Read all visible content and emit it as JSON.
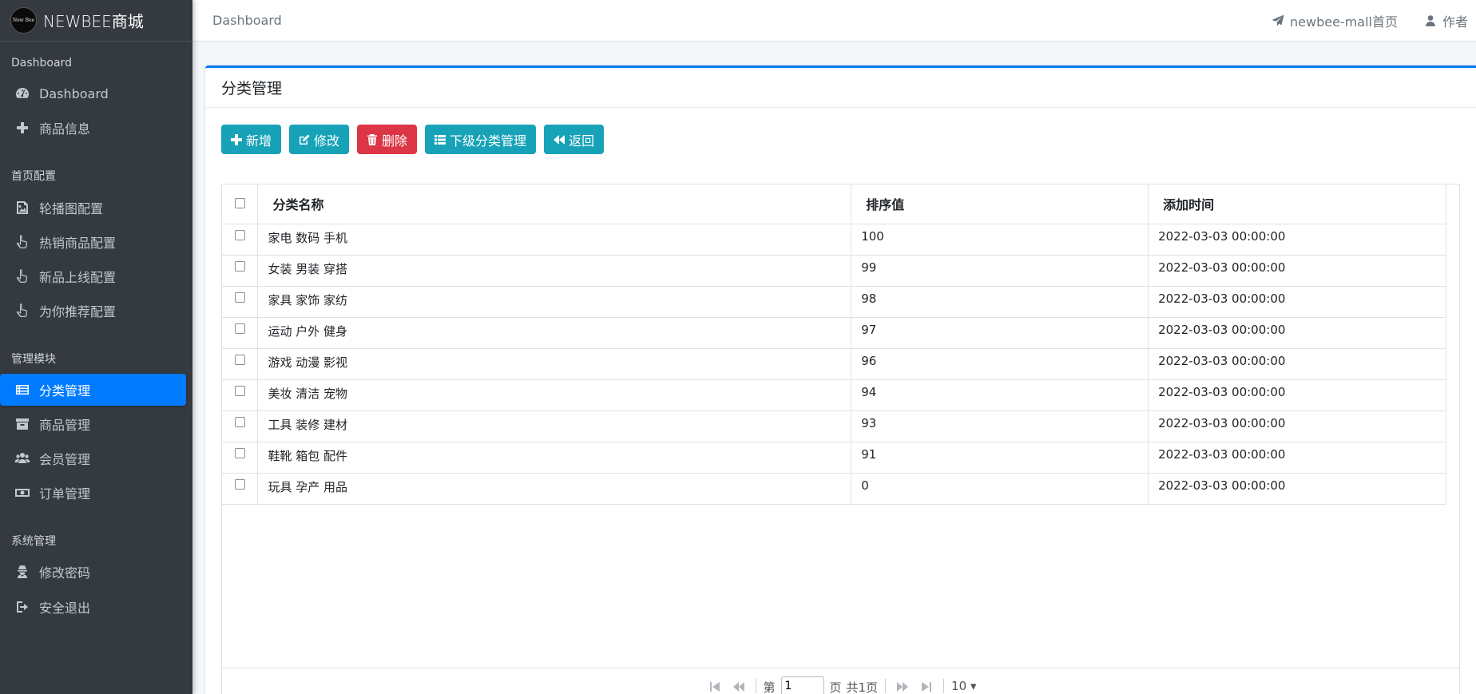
{
  "brand": {
    "logo_text": "New Bee",
    "title": "NEWBEE商城"
  },
  "topbar": {
    "left_label": "Dashboard",
    "links": [
      {
        "icon": "paper-plane-icon",
        "label": "newbee-mall首页"
      },
      {
        "icon": "user-icon",
        "label": "作者"
      }
    ]
  },
  "sidebar": {
    "sections": [
      {
        "header": "Dashboard",
        "items": [
          {
            "icon": "tachometer-icon",
            "label": "Dashboard"
          },
          {
            "icon": "plus-icon",
            "label": "商品信息"
          }
        ]
      },
      {
        "header": "首页配置",
        "items": [
          {
            "icon": "image-icon",
            "label": "轮播图配置"
          },
          {
            "icon": "pointer-hand-icon",
            "label": "热销商品配置"
          },
          {
            "icon": "pointer-hand-icon",
            "label": "新品上线配置"
          },
          {
            "icon": "pointer-hand-icon",
            "label": "为你推荐配置"
          }
        ]
      },
      {
        "header": "管理模块",
        "items": [
          {
            "icon": "list-icon",
            "label": "分类管理",
            "active": true
          },
          {
            "icon": "archive-icon",
            "label": "商品管理"
          },
          {
            "icon": "users-icon",
            "label": "会员管理"
          },
          {
            "icon": "money-icon",
            "label": "订单管理"
          }
        ]
      },
      {
        "header": "系统管理",
        "items": [
          {
            "icon": "user-secret-icon",
            "label": "修改密码"
          },
          {
            "icon": "sign-out-icon",
            "label": "安全退出"
          }
        ]
      }
    ]
  },
  "card": {
    "title": "分类管理",
    "buttons": [
      {
        "icon": "plus-icon",
        "label": "新增",
        "style": "info"
      },
      {
        "icon": "edit-icon",
        "label": "修改",
        "style": "info"
      },
      {
        "icon": "trash-icon",
        "label": "删除",
        "style": "danger"
      },
      {
        "icon": "list-icon",
        "label": "下级分类管理",
        "style": "info"
      },
      {
        "icon": "backward-icon",
        "label": "返回",
        "style": "info"
      }
    ]
  },
  "table": {
    "columns": [
      "分类名称",
      "排序值",
      "添加时间"
    ],
    "rows": [
      {
        "name": "家电 数码 手机",
        "sort": "100",
        "time": "2022-03-03 00:00:00"
      },
      {
        "name": "女装 男装 穿搭",
        "sort": "99",
        "time": "2022-03-03 00:00:00"
      },
      {
        "name": "家具 家饰 家纺",
        "sort": "98",
        "time": "2022-03-03 00:00:00"
      },
      {
        "name": "运动 户外 健身",
        "sort": "97",
        "time": "2022-03-03 00:00:00"
      },
      {
        "name": "游戏 动漫 影视",
        "sort": "96",
        "time": "2022-03-03 00:00:00"
      },
      {
        "name": "美妆 清洁 宠物",
        "sort": "94",
        "time": "2022-03-03 00:00:00"
      },
      {
        "name": "工具 装修 建材",
        "sort": "93",
        "time": "2022-03-03 00:00:00"
      },
      {
        "name": "鞋靴 箱包 配件",
        "sort": "91",
        "time": "2022-03-03 00:00:00"
      },
      {
        "name": "玩具 孕产 用品",
        "sort": "0",
        "time": "2022-03-03 00:00:00"
      }
    ]
  },
  "pager": {
    "page_prefix": "第",
    "page_value": "1",
    "page_suffix": "页",
    "total_label": "共1页",
    "page_size": "10 ▾"
  },
  "colors": {
    "primary": "#007bff",
    "info": "#17a2b8",
    "danger": "#dc3545",
    "sidebar": "#343a40"
  }
}
